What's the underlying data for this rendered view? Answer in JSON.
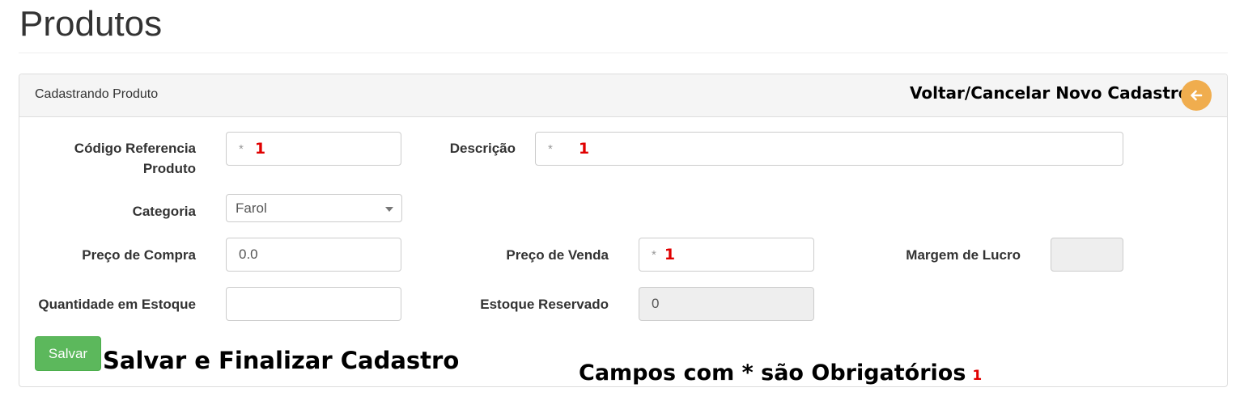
{
  "page": {
    "title": "Produtos"
  },
  "panel": {
    "heading": "Cadastrando Produto",
    "back_annotation": "Voltar/Cancelar Novo Cadastro",
    "back_icon": "arrow-left-icon"
  },
  "form": {
    "codigo": {
      "label_line1": "Código Referencia",
      "label_line2": "Produto",
      "placeholder": "*",
      "value": "1"
    },
    "descricao": {
      "label": "Descrição",
      "placeholder": "*",
      "value": "1"
    },
    "categoria": {
      "label": "Categoria",
      "selected": "Farol"
    },
    "preco_compra": {
      "label": "Preço de Compra",
      "value": "0.0"
    },
    "preco_venda": {
      "label": "Preço de Venda",
      "placeholder": "*",
      "value": "1"
    },
    "margem_lucro": {
      "label": "Margem de Lucro",
      "value": ""
    },
    "quantidade_estoque": {
      "label": "Quantidade em Estoque",
      "value": ""
    },
    "estoque_reservado": {
      "label": "Estoque Reservado",
      "value": "0"
    }
  },
  "actions": {
    "save_label": "Salvar",
    "save_annotation": "Salvar e Finalizar Cadastro",
    "required_annotation": "Campos com * são Obrigatórios",
    "required_marker": "1"
  },
  "colors": {
    "save_button": "#5cb85c",
    "back_button": "#f0ad4e",
    "annotation_marker": "#e00000"
  }
}
